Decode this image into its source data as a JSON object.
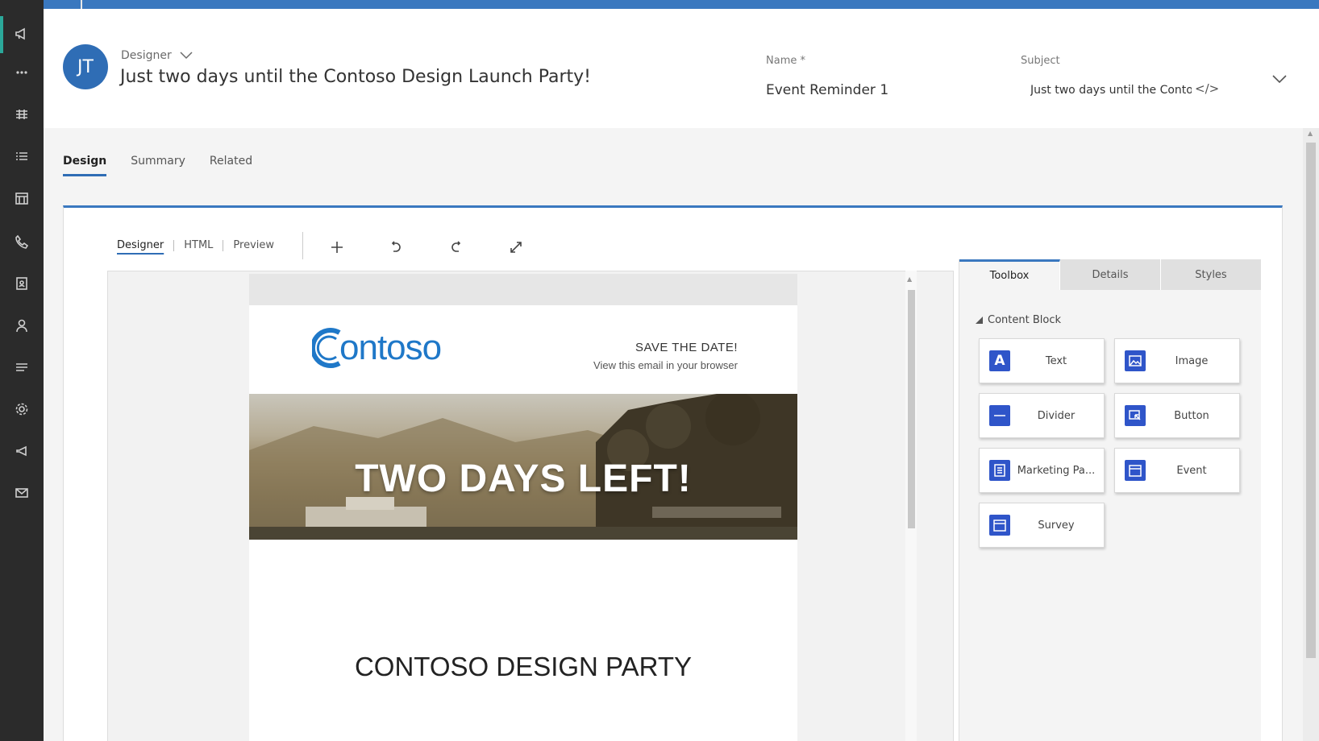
{
  "header": {
    "avatar_initials": "JT",
    "form_type": "Designer",
    "record_title": "Just two days until the Contoso Design Launch Party!",
    "name_label": "Name *",
    "name_value": "Event Reminder 1",
    "subject_label": "Subject",
    "subject_value": "Just two days until the Contoso Design Launch Party!",
    "subject_code_icon": "</>"
  },
  "form_tabs": [
    "Design",
    "Summary",
    "Related"
  ],
  "active_form_tab": "Design",
  "editor": {
    "modes": [
      "Designer",
      "HTML",
      "Preview"
    ],
    "active_mode": "Designer",
    "tools": [
      "add-icon",
      "undo-icon",
      "redo-icon",
      "expand-icon"
    ]
  },
  "email": {
    "logo_text": "ontoso",
    "save_the_date": "SAVE THE DATE!",
    "view_in_browser": "View this email in your browser",
    "hero_text": "TWO DAYS LEFT!",
    "party_title": "CONTOSO DESIGN PARTY"
  },
  "panel": {
    "tabs": [
      "Toolbox",
      "Details",
      "Styles"
    ],
    "active_tab": "Toolbox",
    "section_title": "Content Block",
    "blocks": [
      {
        "label": "Text",
        "icon": "text-icon"
      },
      {
        "label": "Image",
        "icon": "image-icon"
      },
      {
        "label": "Divider",
        "icon": "divider-icon"
      },
      {
        "label": "Button",
        "icon": "button-icon"
      },
      {
        "label": "Marketing Pa...",
        "icon": "marketing-page-icon"
      },
      {
        "label": "Event",
        "icon": "event-icon"
      },
      {
        "label": "Survey",
        "icon": "survey-icon"
      }
    ]
  },
  "colors": {
    "brand_blue": "#3a78bf",
    "rail_bg": "#2b2b2b",
    "rail_active": "#2ba89a",
    "block_icon": "#2f55c9",
    "logo_blue": "#1f78c8"
  }
}
